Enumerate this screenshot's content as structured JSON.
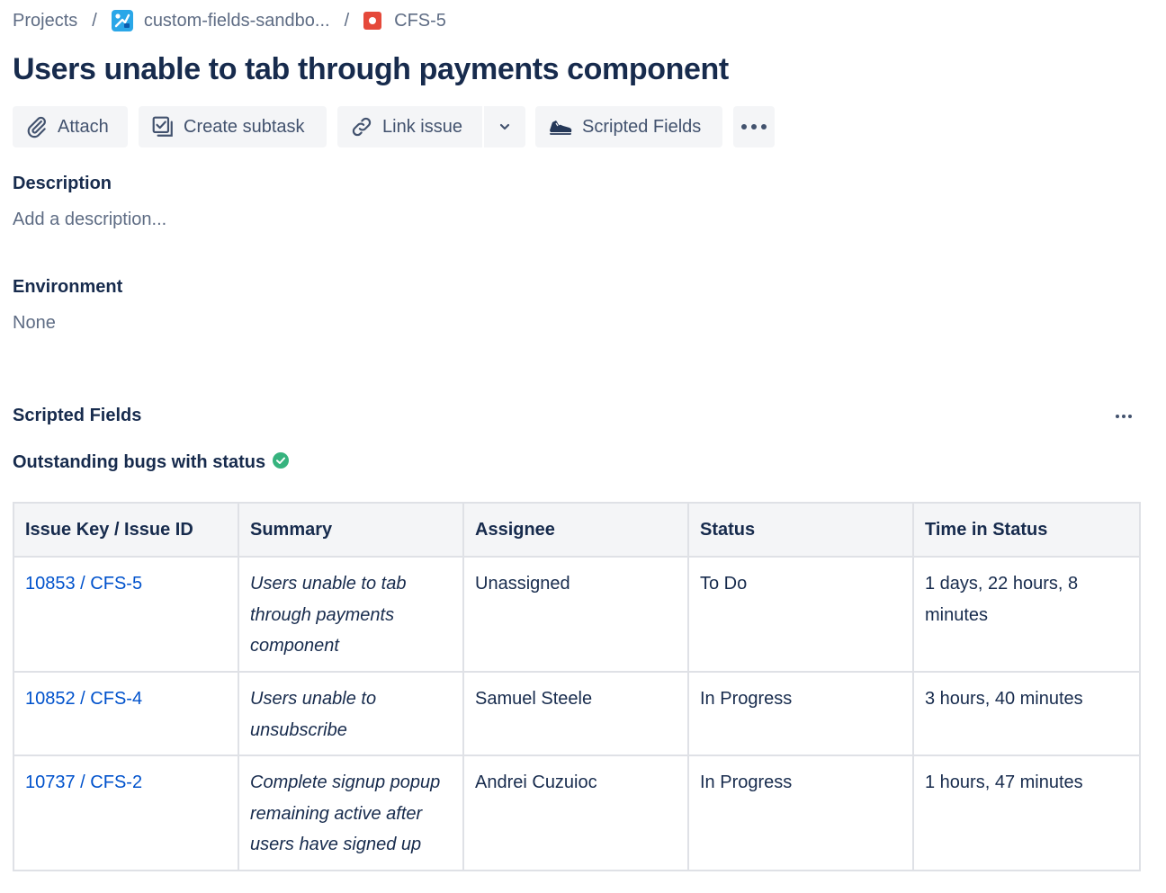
{
  "breadcrumb": {
    "projects": "Projects",
    "project_name": "custom-fields-sandbo...",
    "issue_key": "CFS-5",
    "separator": "/"
  },
  "issue": {
    "title": "Users unable to tab through payments component"
  },
  "toolbar": {
    "attach_label": "Attach",
    "create_subtask_label": "Create subtask",
    "link_issue_label": "Link issue",
    "scripted_fields_label": "Scripted Fields"
  },
  "description": {
    "heading": "Description",
    "placeholder": "Add a description..."
  },
  "environment": {
    "heading": "Environment",
    "value": "None"
  },
  "scripted_fields": {
    "heading": "Scripted Fields",
    "field_title": "Outstanding bugs with status",
    "columns": [
      "Issue Key / Issue ID",
      "Summary",
      "Assignee",
      "Status",
      "Time in Status"
    ],
    "rows": [
      {
        "key": "10853 / CFS-5",
        "summary": "Users unable to tab through payments component",
        "assignee": "Unassigned",
        "status": "To Do",
        "time": "1 days, 22 hours, 8 minutes"
      },
      {
        "key": "10852 / CFS-4",
        "summary": "Users unable to unsubscribe",
        "assignee": "Samuel Steele",
        "status": "In Progress",
        "time": "3 hours, 40 minutes"
      },
      {
        "key": "10737 / CFS-2",
        "summary": "Complete signup popup remaining active after users have signed up",
        "assignee": "Andrei Cuzuioc",
        "status": "In Progress",
        "time": "1 hours, 47 minutes"
      }
    ]
  },
  "icons": {
    "attach": "paperclip-icon",
    "subtask": "subtask-icon",
    "link": "link-icon",
    "dropdown": "chevron-down-icon",
    "scripted": "sneaker-icon",
    "more": "more-horizontal-icon",
    "status_ok": "check-circle-icon"
  },
  "colors": {
    "link": "#0052cc",
    "text": "#172b4d",
    "muted": "#5e6c84",
    "button_bg": "#f4f5f7",
    "success": "#36b37e",
    "issue_type": "#e5493a"
  }
}
